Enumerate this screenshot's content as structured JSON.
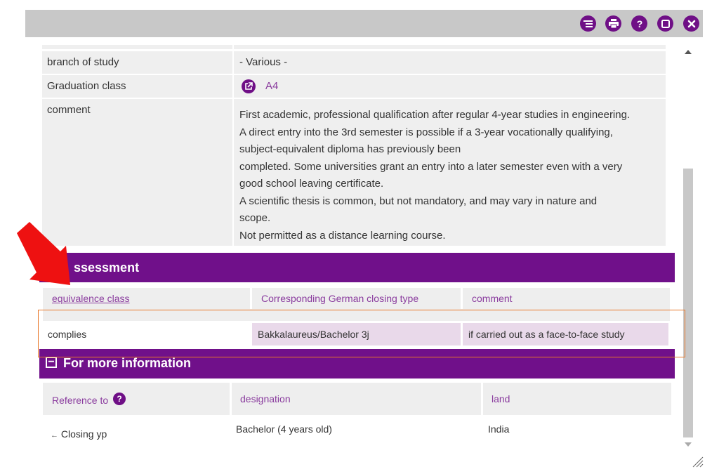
{
  "toolbar": {
    "icons": [
      "list-icon",
      "print-icon",
      "help-icon",
      "maximize-icon",
      "close-icon"
    ]
  },
  "details": {
    "branch_label": "branch of study",
    "branch_value": "- Various -",
    "graduation_label": "Graduation class",
    "graduation_value": "A4",
    "comment_label": "comment",
    "comment_lines": [
      "First academic, professional qualification after regular 4-year studies in engineering.",
      "A direct entry into the 3rd semester is possible if a 3-year vocationally qualifying,",
      "subject-equivalent diploma has previously been",
      "completed. Some universities grant an entry into a later semester even with a very",
      "good school leaving certificate.",
      "A scientific thesis is common, but not mandatory, and may vary in nature and",
      "scope.",
      "Not permitted as a distance learning course."
    ]
  },
  "assessment": {
    "title": "ssessment",
    "columns": [
      "equivalence class",
      "Corresponding German closing type",
      "comment"
    ],
    "row": [
      "complies",
      "Bakkalaureus/Bachelor 3j",
      "if carried out as a face-to-face study"
    ]
  },
  "more_info": {
    "title": "For more information",
    "collapse_symbol": "−",
    "columns": [
      "Reference to",
      "designation",
      "land"
    ],
    "help_symbol": "?",
    "row": [
      "Closing yp",
      "Bachelor (4 years old)",
      "India"
    ],
    "arrow_symbol": "←"
  },
  "colors": {
    "accent": "#70108a",
    "highlight": "#e9d9ea",
    "annotation_arrow": "#ee1111",
    "annotation_box": "#e8782a"
  }
}
